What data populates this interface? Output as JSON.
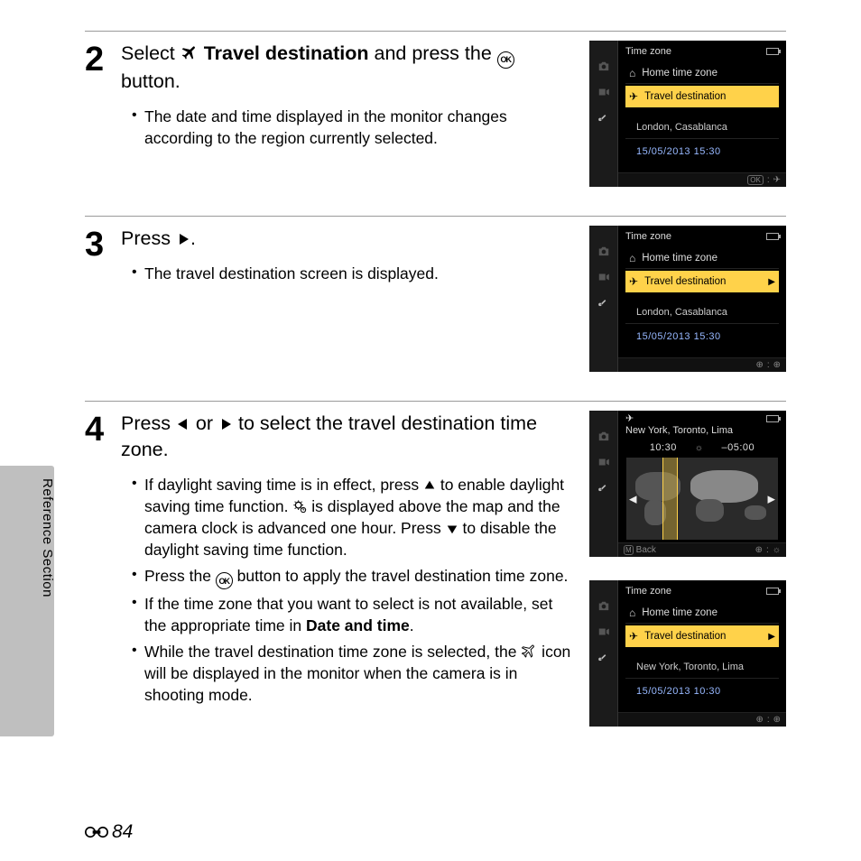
{
  "section_label": "Reference Section",
  "page_number": "84",
  "steps": {
    "s2": {
      "number": "2",
      "head_1": "Select ",
      "head_bold": "Travel destination",
      "head_2": " and press the ",
      "head_3": " button.",
      "bullet1": "The date and time displayed in the monitor changes according to the region currently selected."
    },
    "s3": {
      "number": "3",
      "head_1": "Press ",
      "head_2": ".",
      "bullet1": "The travel destination screen is displayed."
    },
    "s4": {
      "number": "4",
      "head_1": "Press ",
      "head_2": " or ",
      "head_3": " to select the travel destination time zone.",
      "b1a": "If daylight saving time is in effect, press ",
      "b1b": " to enable daylight saving time function. ",
      "b1c": " is displayed above the map and the camera clock is advanced one hour. Press ",
      "b1d": " to disable the daylight saving time function.",
      "b2a": "Press the ",
      "b2b": " button to apply the travel destination time zone.",
      "b3a": "If the time zone that you want to select is not available, set the appropriate time in ",
      "b3b": "Date and time",
      "b3c": ".",
      "b4a": "While the travel destination time zone is selected, the ",
      "b4b": " icon will be displayed in the monitor when the camera is in shooting mode."
    }
  },
  "lcd": {
    "title": "Time zone",
    "home": "Home time zone",
    "travel": "Travel destination",
    "loc_europe": "London, Casablanca",
    "loc_ny": "New York, Toronto, Lima",
    "dt1": "15/05/2013  15:30",
    "dt_ny": "15/05/2013  10:30",
    "map_t1": "10:30",
    "map_t2": "–05:00",
    "back": "Back"
  }
}
